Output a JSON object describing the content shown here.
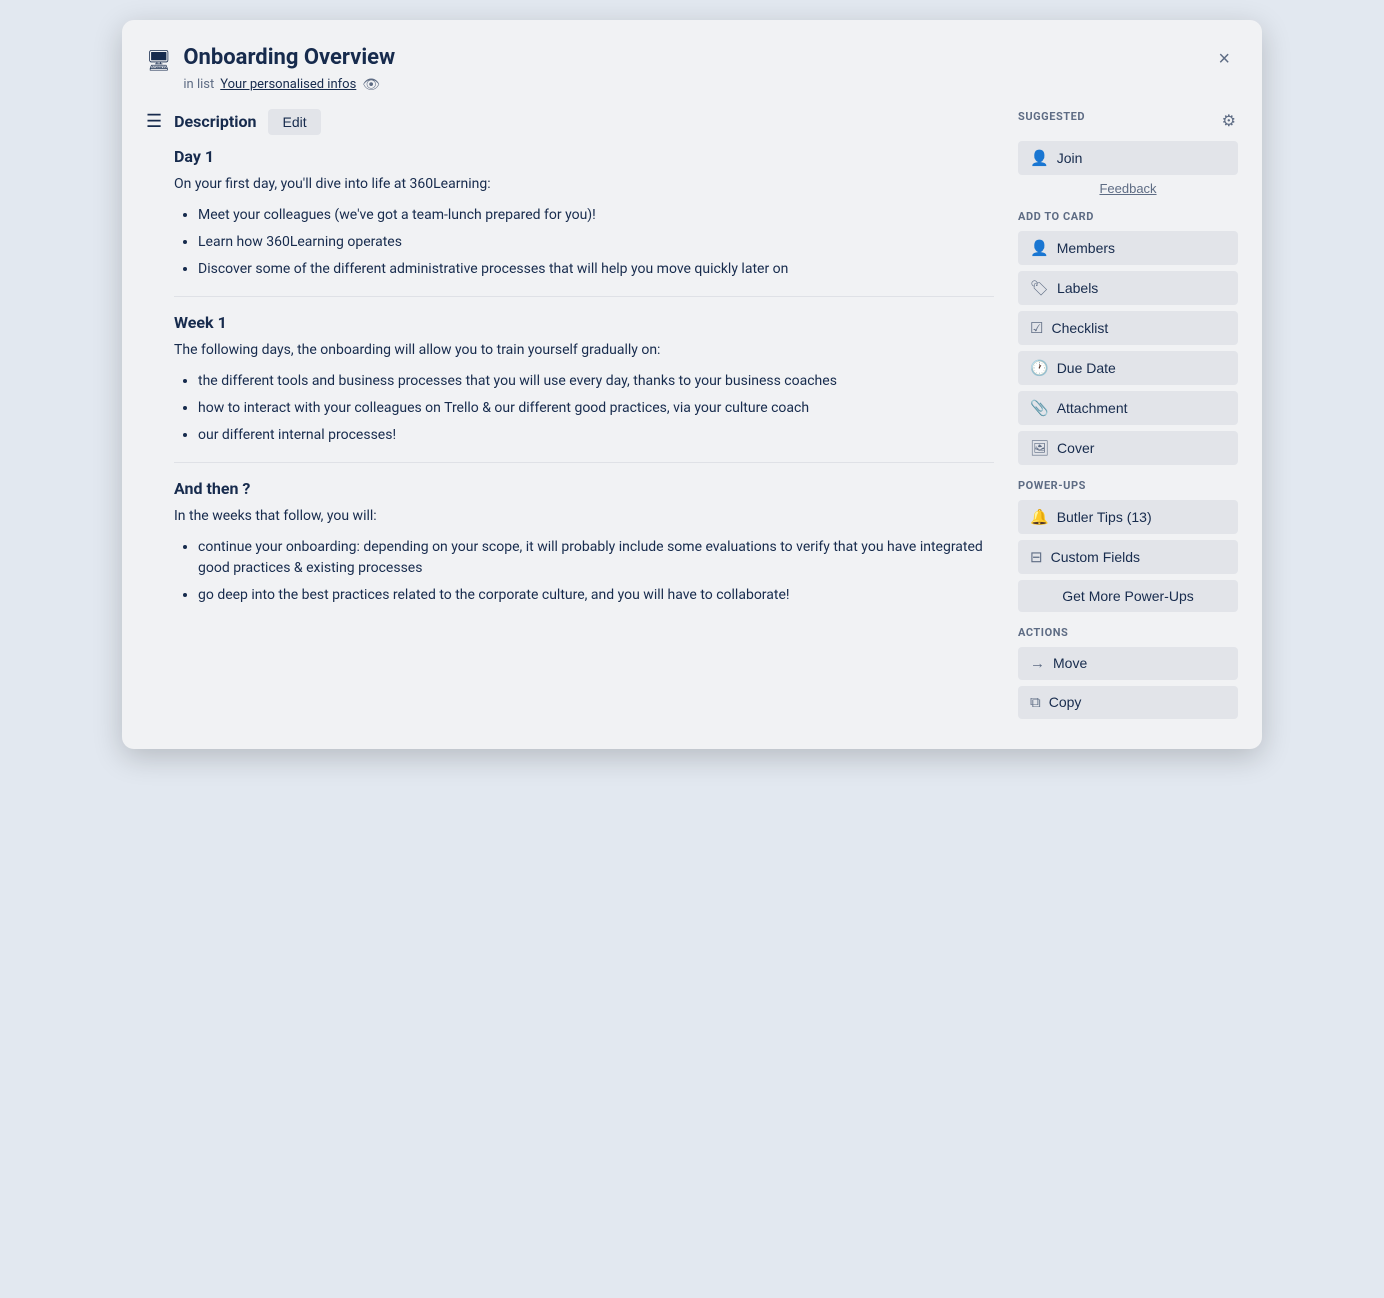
{
  "modal": {
    "title": "Onboarding Overview",
    "subtitle_prefix": "in list",
    "list_link": "Your personalised infos",
    "close_label": "×"
  },
  "description": {
    "label": "Description",
    "edit_label": "Edit"
  },
  "sections": [
    {
      "id": "day1",
      "title": "Day 1",
      "intro": "On your first day, you'll dive into life at 360Learning:",
      "bullets": [
        "Meet your colleagues (we've got a team-lunch prepared for you)!",
        "Learn how 360Learning operates",
        "Discover some of the different administrative processes that will help you move quickly later on"
      ]
    },
    {
      "id": "week1",
      "title": "Week 1",
      "intro": "The following days, the onboarding will allow you to train yourself gradually on:",
      "bullets": [
        "the different tools and business processes that you will use every day, thanks to your business coaches",
        "how to interact with your colleagues on Trello & our different good practices, via your culture coach",
        "our different internal processes!"
      ]
    },
    {
      "id": "andthen",
      "title": "And then ?",
      "intro": "In the weeks that follow, you will:",
      "bullets": [
        "continue your onboarding: depending on your scope, it will probably include some evaluations to verify that you have integrated good practices & existing processes",
        "go deep into the best practices related to the corporate culture, and you will have to collaborate!"
      ]
    }
  ],
  "sidebar": {
    "suggested_label": "SUGGESTED",
    "join_label": "Join",
    "feedback_label": "Feedback",
    "add_to_card_label": "ADD TO CARD",
    "add_items": [
      {
        "id": "members",
        "icon": "person",
        "label": "Members"
      },
      {
        "id": "labels",
        "icon": "tag",
        "label": "Labels"
      },
      {
        "id": "checklist",
        "icon": "check",
        "label": "Checklist"
      },
      {
        "id": "due-date",
        "icon": "clock",
        "label": "Due Date"
      },
      {
        "id": "attachment",
        "icon": "paperclip",
        "label": "Attachment"
      },
      {
        "id": "cover",
        "icon": "image",
        "label": "Cover"
      }
    ],
    "power_ups_label": "POWER-UPS",
    "power_up_items": [
      {
        "id": "butler-tips",
        "icon": "bell",
        "label": "Butler Tips (13)"
      },
      {
        "id": "custom-fields",
        "icon": "fields",
        "label": "Custom Fields"
      }
    ],
    "get_more_label": "Get More Power-Ups",
    "actions_label": "ACTIONS",
    "action_items": [
      {
        "id": "move",
        "icon": "arrow",
        "label": "Move"
      },
      {
        "id": "copy",
        "icon": "copy",
        "label": "Copy"
      }
    ]
  }
}
